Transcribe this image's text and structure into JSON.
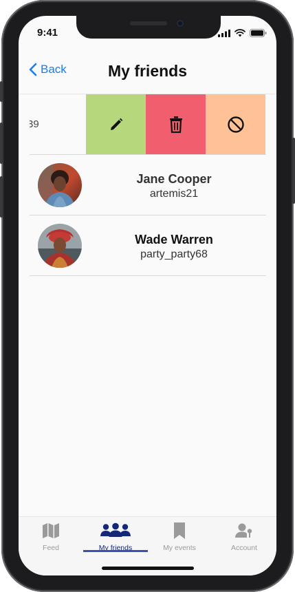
{
  "status_bar": {
    "time": "9:41"
  },
  "header": {
    "back_label": "Back",
    "title": "My friends"
  },
  "swiped_row": {
    "partial_text": "39",
    "actions": [
      {
        "name": "edit",
        "icon": "pencil-icon",
        "color": "#b6d77b"
      },
      {
        "name": "delete",
        "icon": "trash-icon",
        "color": "#f15f6e"
      },
      {
        "name": "block",
        "icon": "block-icon",
        "color": "#ffc196"
      }
    ]
  },
  "friends": [
    {
      "name": "Jane Cooper",
      "username": "artemis21"
    },
    {
      "name": "Wade Warren",
      "username": "party_party68"
    }
  ],
  "tabbar": {
    "tabs": [
      {
        "label": "Feed",
        "icon": "map-icon"
      },
      {
        "label": "My friends",
        "icon": "friends-icon",
        "active": true
      },
      {
        "label": "My events",
        "icon": "bookmark-icon"
      },
      {
        "label": "Account",
        "icon": "account-icon"
      }
    ]
  },
  "colors": {
    "accent": "#1a7cf2",
    "active_tab": "#14287a"
  }
}
